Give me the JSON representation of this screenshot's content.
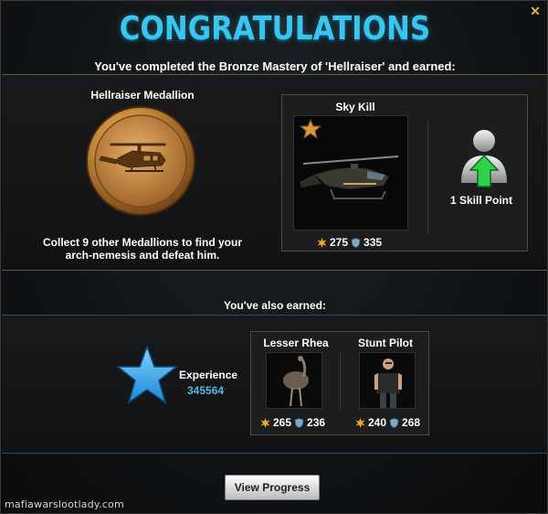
{
  "header": {
    "title": "CONGRATULATIONS",
    "subtitle": "You've completed the Bronze Mastery of 'Hellraiser' and earned:"
  },
  "medallion": {
    "title": "Hellraiser Medallion",
    "description": "Collect 9 other Medallions to find your arch-nemesis and defeat him."
  },
  "main_reward": {
    "name": "Sky Kill",
    "attack": "275",
    "defense": "335",
    "skill_label": "1 Skill Point"
  },
  "extra": {
    "heading": "You've also earned:",
    "experience_label": "Experience",
    "experience_value": "345564",
    "loot": [
      {
        "name": "Lesser Rhea",
        "attack": "265",
        "defense": "236"
      },
      {
        "name": "Stunt Pilot",
        "attack": "240",
        "defense": "268"
      }
    ]
  },
  "buttons": {
    "view_progress": "View Progress",
    "close": "✕"
  },
  "watermark": "mafiawarslootlady.com",
  "colors": {
    "title": "#39c6ee",
    "accent_gold": "#d8b540",
    "xp_value": "#4db8e8",
    "skill_green": "#2fd14a"
  },
  "icons": [
    "close-icon",
    "medallion-icon",
    "helicopter-icon",
    "star-rank-icon",
    "attack-icon",
    "defense-icon",
    "skill-point-icon",
    "experience-star-icon",
    "rhea-icon",
    "stunt-pilot-icon"
  ]
}
